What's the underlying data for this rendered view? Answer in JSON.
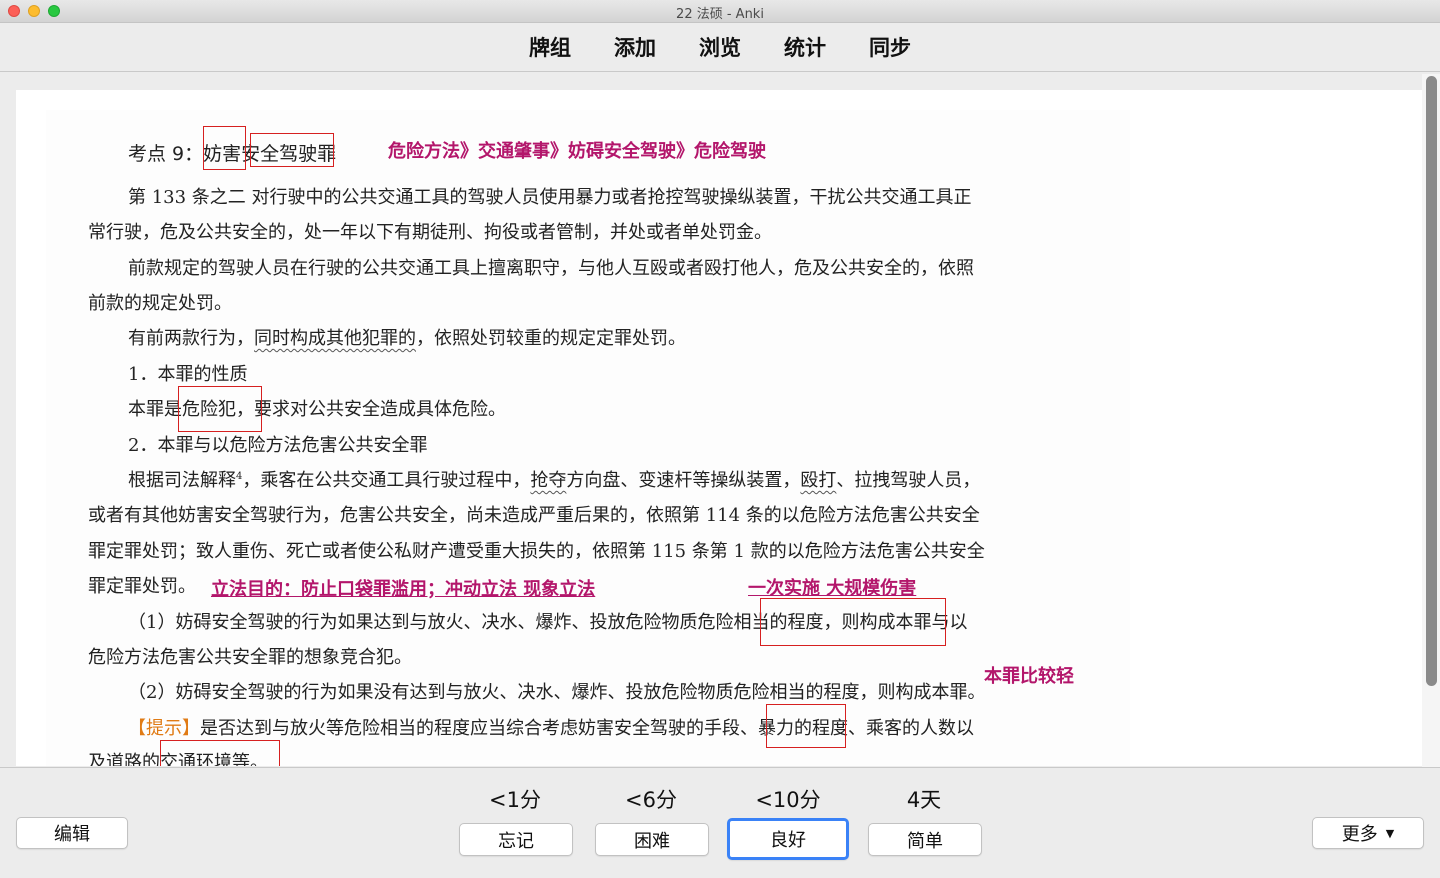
{
  "window": {
    "title": "22 法硕 - Anki"
  },
  "toolbar": {
    "items": [
      "牌组",
      "添加",
      "浏览",
      "统计",
      "同步"
    ]
  },
  "card": {
    "heading_prefix": "考点 9：",
    "heading_w1": "妨害",
    "heading_w2": "安全驾驶",
    "heading_w3": "罪",
    "heading_note": "危险方法》交通肇事》妨碍安全驾驶》危险驾驶",
    "p1_l1": "第 133 条之二  对行驶中的公共交通工具的驾驶人员使用暴力或者抢控驾驶操纵装置，干扰公共交通工具正",
    "p1_l2": "常行驶，危及公共安全的，处一年以下有期徒刑、拘役或者管制，并处或者单处罚金。",
    "p2_l1": "前款规定的驾驶人员在行驶的公共交通工具上擅离职守，与他人互殴或者殴打他人，危及公共安全的，依照",
    "p2_l2": "前款的规定处罚。",
    "p3_a": "有前两款行为，",
    "p3_b": "同时构成其他犯罪的",
    "p3_c": "，依照处罚较重的规定定罪处罚。",
    "s1_title": "1．本罪的性质",
    "s1_a": "本罪是",
    "s1_b": "危险犯",
    "s1_c": "，要求对公共安全造成具体危险。",
    "s2_title": "2．本罪与以危险方法危害公共安全罪",
    "p4_a": "根据司法解释",
    "p4_sup": "4",
    "p4_b": "，乘客在公共交通工具行驶过程中，",
    "p4_c": "抢夺",
    "p4_d": "方向盘、变速杆等操纵装置，",
    "p4_e": "殴打",
    "p4_f": "、拉拽驾驶人员，",
    "p4_l2": "或者有其他妨害安全驾驶行为，危害公共安全，尚未造成严重后果的，依照第 114 条的以危险方法危害公共安全",
    "p4_l3": "罪定罪处罚；致人重伤、死亡或者使公私财产遭受重大损失的，依照第 115 条第 1 款的以危险方法危害公共安全",
    "p4_l4": "罪定罪处罚。",
    "note_purpose": "立法目的：防止口袋罪滥用；冲动立法 现象立法",
    "note_once": "一次实施 大规模伤害",
    "p5_a": "（1）妨碍安全驾驶的行为如果达到与放火、决水、爆炸、投放危险物",
    "p5_b": "质危险相当的程度，",
    "p5_c": "则构成本罪与以",
    "p5_l2": "危险方法危害公共安全罪的想象竞合犯。",
    "note_lighter": "本罪比较轻",
    "p6": "（2）妨碍安全驾驶的行为如果没有达到与放火、决水、爆炸、投放危险物质危险相当的程度，则构成本罪。",
    "p7_tip": "【提示】",
    "p7_a": "是否达到与放火等危险相当的程度应当综合考虑妨害安全驾驶",
    "p7_b": "的手段、",
    "p7_c": "暴力的程度、乘客的人数以",
    "p7_l2": "及道路的交通环境等。"
  },
  "answer": {
    "intervals": [
      "<1分",
      "<6分",
      "<10分",
      "4天"
    ],
    "buttons": [
      "忘记",
      "困难",
      "良好",
      "简单"
    ],
    "edit_label": "编辑",
    "more_label": "更多"
  },
  "colors": {
    "note": "#b3166b",
    "box": "#d62020",
    "focus": "#3a82f7",
    "tip": "#e07b15"
  }
}
